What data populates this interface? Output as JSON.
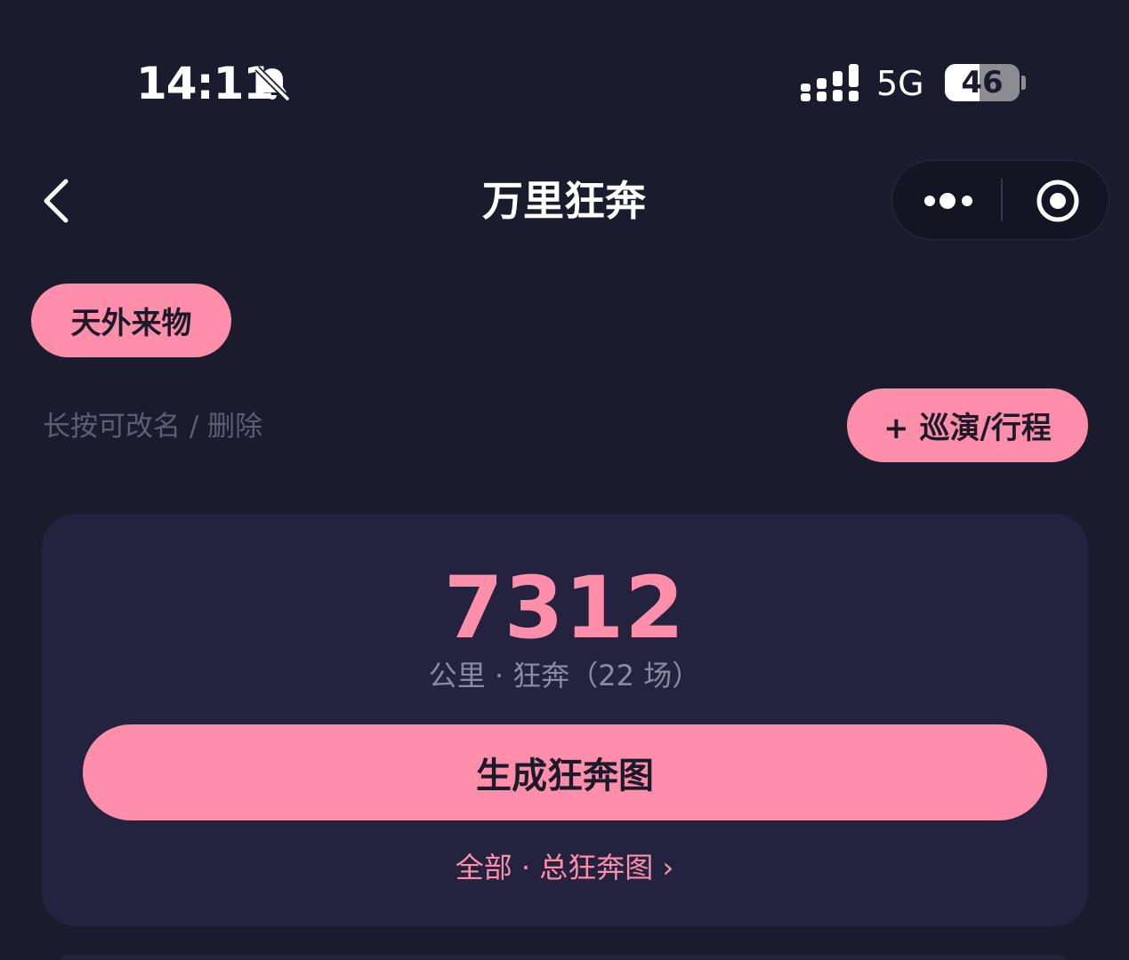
{
  "status_bar": {
    "time": "14:11",
    "network": "5G",
    "battery": "46",
    "battery_level": 0.46
  },
  "nav": {
    "title": "万里狂奔"
  },
  "tag": {
    "label": "天外来物"
  },
  "hint": "长按可改名 / 删除",
  "add_button": "+ 巡演/行程",
  "card": {
    "distance": "7312",
    "caption": "公里 · 狂奔（22 场）",
    "generate_button": "生成狂奔图",
    "all_link": "全部 · 总狂奔图 ›"
  },
  "colors": {
    "background": "#1b1b2e",
    "card": "#23233f",
    "accent": "#ff8eab"
  },
  "icons": [
    "bell-muted-icon",
    "signal-icon",
    "battery-icon",
    "back-icon",
    "more-icon",
    "close-icon"
  ]
}
